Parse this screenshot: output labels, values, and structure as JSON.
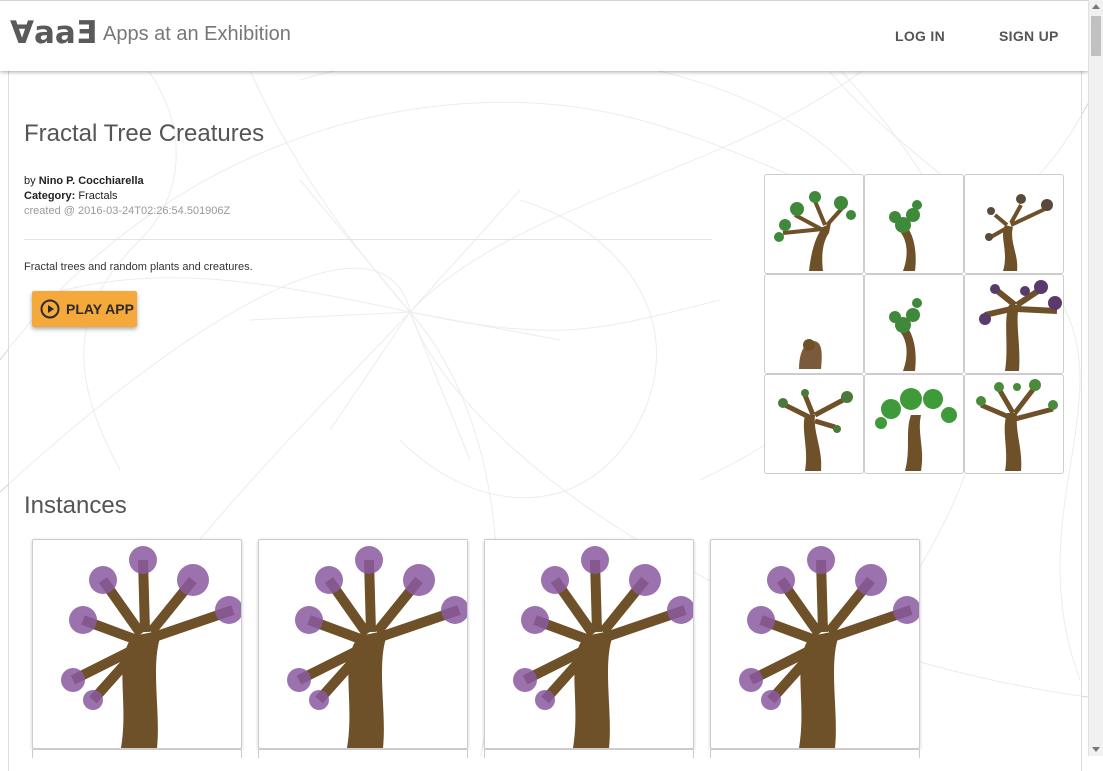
{
  "header": {
    "logo_text": "∀aaƎ",
    "site_title": "Apps at an Exhibition",
    "login_label": "LOG IN",
    "signup_label": "SIGN UP"
  },
  "app": {
    "title": "Fractal Tree Creatures",
    "by_prefix": "by",
    "author": "Nino P. Cocchiarella",
    "category_label": "Category:",
    "category": "Fractals",
    "created": "created @ 2016-03-24T02:26:54.501906Z",
    "description": "Fractal trees and random plants and creatures.",
    "play_label": "PLAY APP"
  },
  "thumbnails": [
    {
      "foliage": "#3f8a3a"
    },
    {
      "foliage": "#3f8a3a"
    },
    {
      "foliage": "#5a4a3a"
    },
    {
      "foliage": "#7a5a3a"
    },
    {
      "foliage": "#3f8a3a"
    },
    {
      "foliage": "#5a3a6a"
    },
    {
      "foliage": "#4a7a3a"
    },
    {
      "foliage": "#3f9a3a"
    },
    {
      "foliage": "#4a8a3a"
    }
  ],
  "instances_heading": "Instances",
  "instances": [
    {
      "foliage": "#8a5aa0"
    },
    {
      "foliage": "#8a5aa0"
    },
    {
      "foliage": "#8a5aa0"
    },
    {
      "foliage": "#8a5aa0"
    }
  ],
  "colors": {
    "trunk": "#6e5128",
    "play_button": "#f5a93a"
  },
  "icons": {
    "play": "play-circle-icon"
  }
}
